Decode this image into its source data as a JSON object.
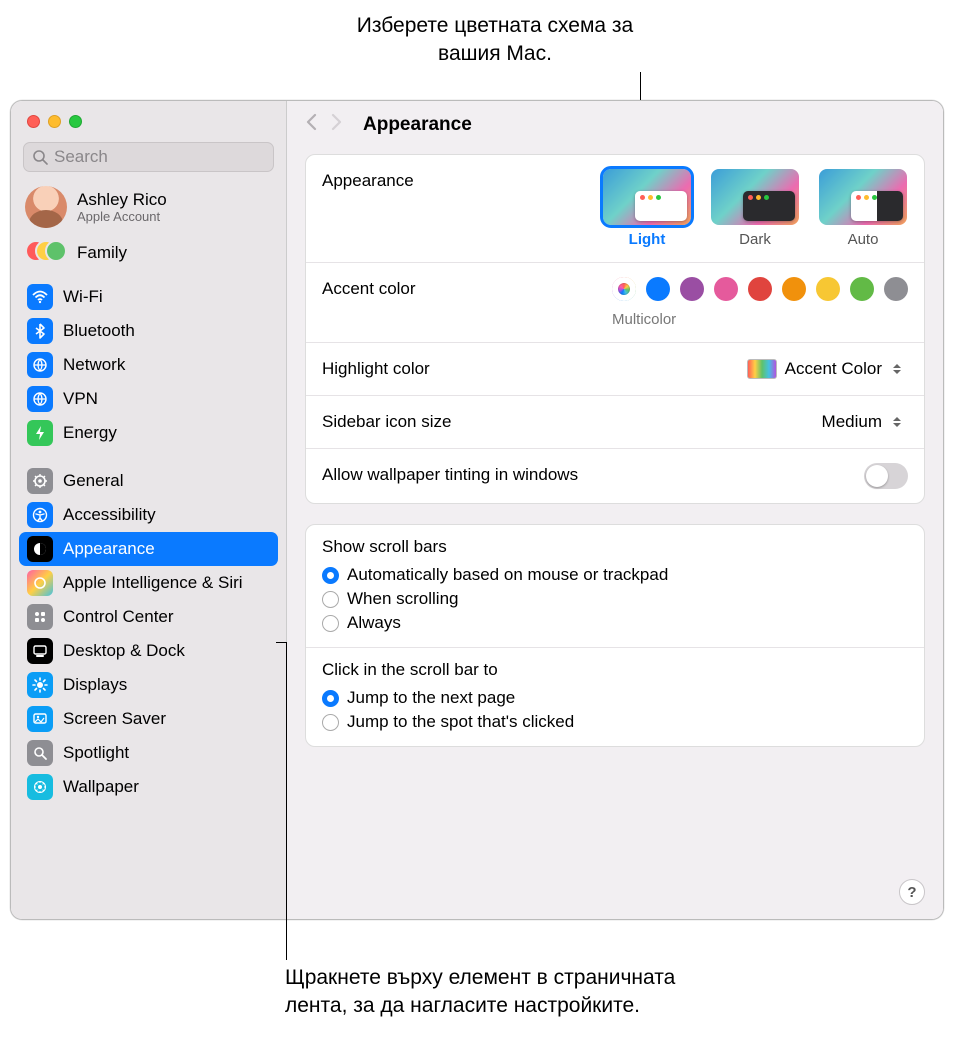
{
  "callouts": {
    "top": "Изберете цветната схема за вашия Mac.",
    "bottom": "Щракнете върху елемент в страничната лента, за да нагласите настройките."
  },
  "search_placeholder": "Search",
  "account": {
    "name": "Ashley Rico",
    "subtitle": "Apple Account"
  },
  "family_label": "Family",
  "sidebar_selected": "Appearance",
  "sidebar_groups": [
    [
      {
        "id": "wifi",
        "label": "Wi-Fi",
        "bg": "#0a7aff"
      },
      {
        "id": "bluetooth",
        "label": "Bluetooth",
        "bg": "#0a7aff"
      },
      {
        "id": "network",
        "label": "Network",
        "bg": "#0a7aff"
      },
      {
        "id": "vpn",
        "label": "VPN",
        "bg": "#0a7aff"
      },
      {
        "id": "energy",
        "label": "Energy",
        "bg": "#34c759"
      }
    ],
    [
      {
        "id": "general",
        "label": "General",
        "bg": "#8e8e93"
      },
      {
        "id": "accessibility",
        "label": "Accessibility",
        "bg": "#0a7aff"
      },
      {
        "id": "appearance",
        "label": "Appearance",
        "bg": "#000"
      },
      {
        "id": "apple-intelligence",
        "label": "Apple Intelligence & Siri",
        "bg": "linear-gradient(135deg,#ff5fa2,#ffcf45,#45c1e0)"
      },
      {
        "id": "control-center",
        "label": "Control Center",
        "bg": "#8e8e93"
      },
      {
        "id": "desktop-dock",
        "label": "Desktop & Dock",
        "bg": "#000"
      },
      {
        "id": "displays",
        "label": "Displays",
        "bg": "#0a9df6"
      },
      {
        "id": "screen-saver",
        "label": "Screen Saver",
        "bg": "#0a9df6"
      },
      {
        "id": "spotlight",
        "label": "Spotlight",
        "bg": "#8e8e93"
      },
      {
        "id": "wallpaper",
        "label": "Wallpaper",
        "bg": "#17bce0"
      }
    ]
  ],
  "page_title": "Appearance",
  "appearance": {
    "label": "Appearance",
    "options": [
      {
        "id": "light",
        "label": "Light"
      },
      {
        "id": "dark",
        "label": "Dark"
      },
      {
        "id": "auto",
        "label": "Auto"
      }
    ],
    "selected": "light"
  },
  "accent": {
    "label": "Accent color",
    "selected_label": "Multicolor",
    "colors": [
      "multi",
      "#0a7aff",
      "#9a4ea3",
      "#e55a9c",
      "#e0443e",
      "#f1910c",
      "#f7c733",
      "#62ba46",
      "#8e8e93"
    ]
  },
  "highlight": {
    "label": "Highlight color",
    "value": "Accent Color"
  },
  "sidebar_size": {
    "label": "Sidebar icon size",
    "value": "Medium"
  },
  "tinting": {
    "label": "Allow wallpaper tinting in windows",
    "on": false
  },
  "scrollbars": {
    "title": "Show scroll bars",
    "options": [
      "Automatically based on mouse or trackpad",
      "When scrolling",
      "Always"
    ],
    "selected": 0
  },
  "scrollclick": {
    "title": "Click in the scroll bar to",
    "options": [
      "Jump to the next page",
      "Jump to the spot that's clicked"
    ],
    "selected": 0
  },
  "help_glyph": "?"
}
